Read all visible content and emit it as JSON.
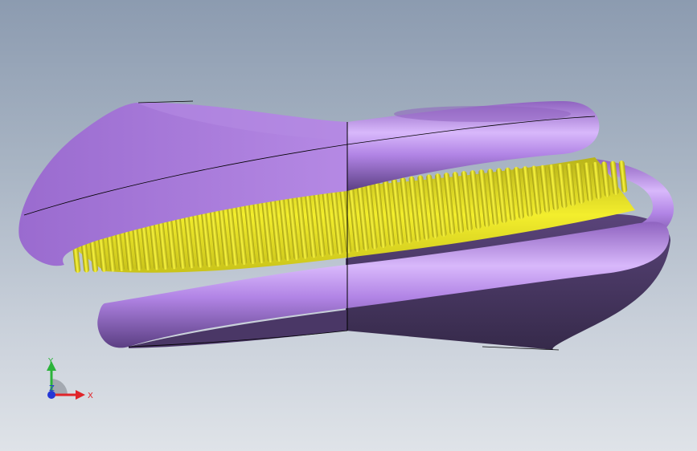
{
  "viewport": {
    "background_top": "#8c9bb0",
    "background_bottom": "#dfe3e8",
    "model": {
      "body_color": "#a978d8",
      "body_shadow_color": "#3f3155",
      "bristle_color": "#f2ee1c",
      "edge_color": "#000000"
    }
  },
  "triad": {
    "x_label": "X",
    "y_label": "Y",
    "z_label": "Z",
    "x_color": "#e0242a",
    "y_color": "#2bb33a",
    "z_color": "#2436d6"
  }
}
